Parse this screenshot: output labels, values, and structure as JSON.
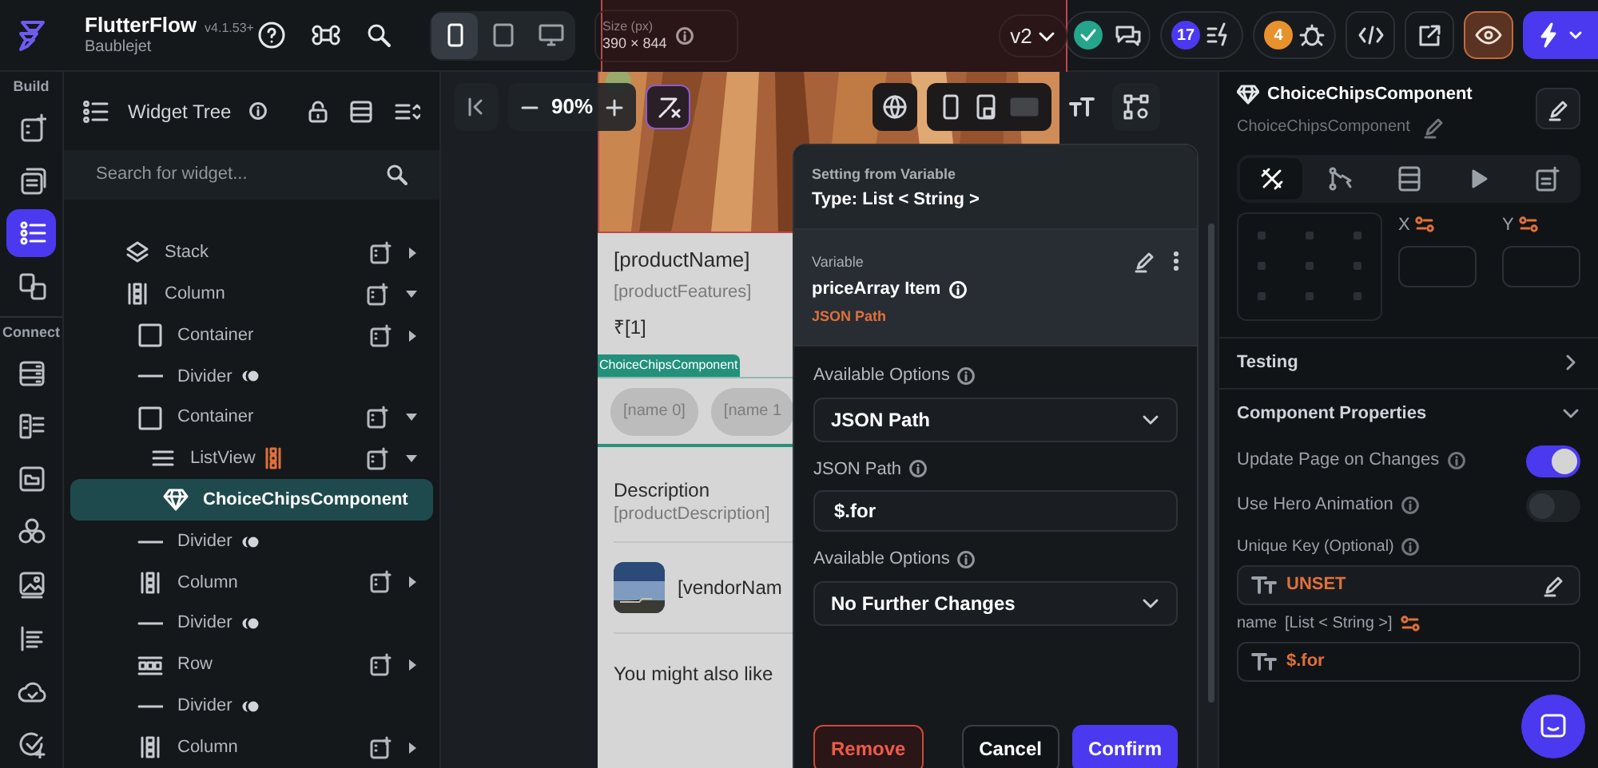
{
  "top_bar": {
    "app_name": "FlutterFlow",
    "version": "v4.1.53+",
    "project": "Baublejet",
    "devices": [
      {
        "selected": true
      },
      {
        "selected": false
      },
      {
        "selected": false
      }
    ],
    "size_label": "Size (px)",
    "size_value": "390 × 844",
    "branch": "v2",
    "badges": [
      {
        "count": "17",
        "color": "#4b39ef"
      },
      {
        "count": "4",
        "color": "#e8922e"
      }
    ]
  },
  "rail": {
    "sections": [
      {
        "label": "Build",
        "items": [
          {
            "selected": false
          },
          {
            "selected": false
          },
          {
            "selected": true
          },
          {
            "selected": false
          }
        ]
      },
      {
        "label": "Connect",
        "items": [
          {
            "selected": false
          },
          {
            "selected": false
          },
          {
            "selected": false
          },
          {
            "selected": false
          },
          {
            "selected": false
          },
          {
            "selected": false
          },
          {
            "selected": false
          },
          {
            "selected": false
          }
        ]
      }
    ]
  },
  "widget_tree": {
    "title": "Widget Tree",
    "search_placeholder": "Search for widget...",
    "nodes": [
      {
        "label": "Stack",
        "kind": "stack",
        "expanded": false,
        "selected": false
      },
      {
        "label": "Column",
        "kind": "column",
        "expanded": true,
        "selected": false,
        "children": [
          {
            "label": "Container",
            "kind": "container",
            "expanded": false,
            "selected": false
          },
          {
            "label": "Divider",
            "kind": "divider",
            "selected": false
          },
          {
            "label": "Container",
            "kind": "container",
            "expanded": true,
            "selected": false,
            "children": [
              {
                "label": "ListView",
                "kind": "listview",
                "expanded": true,
                "selected": false,
                "children": [
                  {
                    "label": "ChoiceChipsComponent",
                    "kind": "component",
                    "selected": true
                  }
                ]
              }
            ]
          },
          {
            "label": "Divider",
            "kind": "divider",
            "selected": false
          },
          {
            "label": "Column",
            "kind": "column",
            "expanded": false,
            "selected": false
          },
          {
            "label": "Divider",
            "kind": "divider",
            "selected": false
          },
          {
            "label": "Row",
            "kind": "row",
            "expanded": false,
            "selected": false
          },
          {
            "label": "Divider",
            "kind": "divider",
            "selected": false
          },
          {
            "label": "Column",
            "kind": "column",
            "expanded": false,
            "selected": false
          }
        ]
      }
    ]
  },
  "canvas": {
    "zoom": "90%"
  },
  "phone": {
    "product_name": "[productName]",
    "product_features": "[productFeatures]",
    "price": "₹[1]",
    "selected_tag": "ChoiceChipsComponent",
    "chips": [
      "[name 0]",
      "[name 1"
    ],
    "description_title": "Description",
    "description": "[productDescription]",
    "vendor": "[vendorNam",
    "related_title": "You might also like"
  },
  "popup": {
    "header_caption": "Setting from Variable",
    "type": "Type: List < String >",
    "variable_caption": "Variable",
    "variable_name": "priceArray Item",
    "variable_source": "JSON Path",
    "fields": [
      {
        "kind": "select",
        "label": "Available Options",
        "value": "JSON Path"
      },
      {
        "kind": "input",
        "label": "JSON Path",
        "value": "$.for"
      },
      {
        "kind": "select",
        "label": "Available Options",
        "value": "No Further Changes"
      }
    ],
    "buttons": [
      {
        "kind": "danger",
        "label": "Remove"
      },
      {
        "kind": "secondary",
        "label": "Cancel"
      },
      {
        "kind": "primary",
        "label": "Confirm"
      }
    ]
  },
  "properties": {
    "title": "ChoiceChipsComponent",
    "subtitle": "ChoiceChipsComponent",
    "tabs": [
      {
        "selected": true
      },
      {
        "selected": false
      },
      {
        "selected": false
      },
      {
        "selected": false
      },
      {
        "selected": false
      }
    ],
    "x_label": "X",
    "y_label": "Y",
    "sections": [
      {
        "title": "Testing",
        "expanded": false
      },
      {
        "title": "Component Properties",
        "expanded": true,
        "rows": [
          {
            "kind": "toggle",
            "label": "Update Page on Changes",
            "on": true
          },
          {
            "kind": "toggle",
            "label": "Use Hero Animation",
            "on": false
          },
          {
            "kind": "param",
            "label": "Unique Key (Optional)",
            "value": "UNSET"
          },
          {
            "kind": "param",
            "label": "name",
            "type": "[List < String >]",
            "value": "$.for"
          }
        ]
      }
    ]
  }
}
